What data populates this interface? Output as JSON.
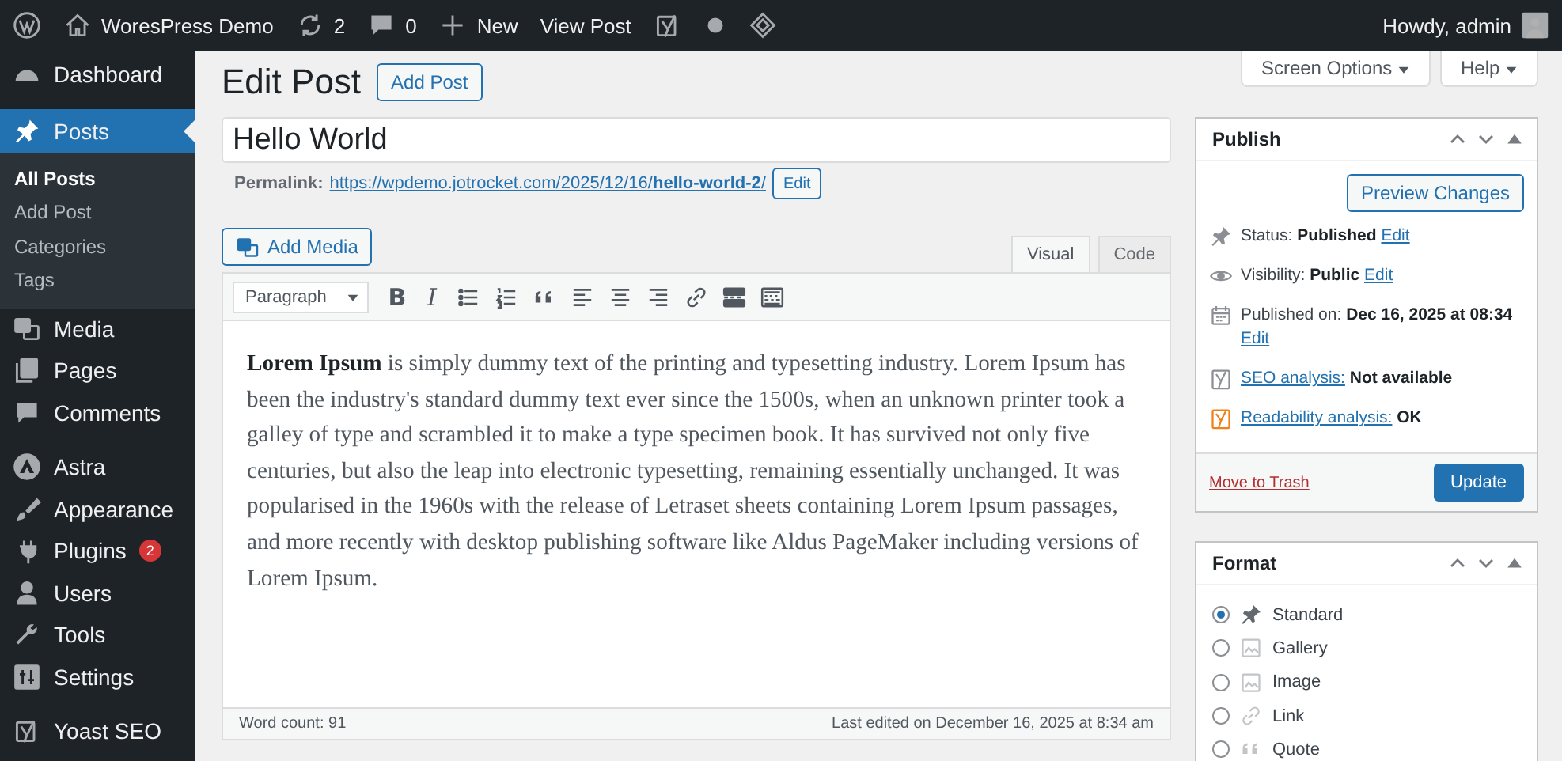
{
  "admin_bar": {
    "items": [
      {
        "kind": "wordpress"
      },
      {
        "kind": "home",
        "label": "WoresPress Demo"
      },
      {
        "kind": "updates",
        "label": "2"
      },
      {
        "kind": "comments",
        "label": "0"
      },
      {
        "kind": "plus",
        "label": "New"
      },
      {
        "kind": "text",
        "label": "View Post"
      },
      {
        "kind": "yoast"
      },
      {
        "kind": "dot"
      },
      {
        "kind": "diamond"
      }
    ],
    "account": "Howdy, admin"
  },
  "sidebar": {
    "groups": [
      {
        "items": [
          {
            "kind": "dashboard",
            "label": "Dashboard",
            "selected": false
          }
        ]
      },
      {
        "items": [
          {
            "kind": "pin",
            "label": "Posts",
            "selected": true,
            "children": [
              {
                "label": "All Posts",
                "selected": true
              },
              {
                "label": "Add Post",
                "selected": false
              },
              {
                "label": "Categories",
                "selected": false
              },
              {
                "label": "Tags",
                "selected": false
              }
            ]
          },
          {
            "kind": "media",
            "label": "Media",
            "selected": false
          },
          {
            "kind": "pages",
            "label": "Pages",
            "selected": false
          },
          {
            "kind": "comments",
            "label": "Comments",
            "selected": false
          }
        ]
      },
      {
        "items": [
          {
            "kind": "astra",
            "label": "Astra",
            "selected": false
          },
          {
            "kind": "appearance",
            "label": "Appearance",
            "selected": false
          },
          {
            "kind": "plugins",
            "label": "Plugins",
            "selected": false,
            "badge": "2"
          },
          {
            "kind": "users",
            "label": "Users",
            "selected": false
          },
          {
            "kind": "tools",
            "label": "Tools",
            "selected": false
          },
          {
            "kind": "settings",
            "label": "Settings",
            "selected": false
          }
        ]
      },
      {
        "items": [
          {
            "kind": "yoast",
            "label": "Yoast SEO",
            "selected": false
          }
        ]
      }
    ]
  },
  "screen_meta": [
    "Screen Options",
    "Help"
  ],
  "header": {
    "title": "Edit Post",
    "button": "Add Post"
  },
  "post_title": "Hello World",
  "permalink": {
    "label": "Permalink:",
    "url": "https://wpdemo.jotrocket.com/2025/12/16/**hello-world-2**/",
    "edit": "Edit"
  },
  "editor": {
    "add_media": "Add Media",
    "tabs": [
      {
        "label": "Visual",
        "selected": true
      },
      {
        "label": "Code",
        "selected": false
      }
    ],
    "format": "Paragraph",
    "tools": [
      {
        "kind": "bold",
        "label": "B"
      },
      {
        "kind": "italic",
        "label": "I"
      },
      {
        "kind": "bullets"
      },
      {
        "kind": "numbers"
      },
      {
        "kind": "quote"
      },
      {
        "kind": "align-left"
      },
      {
        "kind": "align-center"
      },
      {
        "kind": "align-right"
      },
      {
        "kind": "link"
      },
      {
        "kind": "more"
      },
      {
        "kind": "toggle"
      }
    ],
    "content": "**Lorem Ipsum** is simply dummy text of the printing and typesetting industry. Lorem Ipsum has been the industry's standard dummy text ever since the 1500s, when an unknown printer took a galley of type and scrambled it to make a type specimen book. It has survived not only five centuries, but also the leap into electronic typesetting, remaining essentially unchanged. It was popularised in the 1960s with the release of Letraset sheets containing Lorem Ipsum passages, and more recently with desktop publishing software like Aldus PageMaker including versions of Lorem Ipsum.",
    "word_count": "Word count: 91",
    "last_edited": "Last edited on December 16, 2025 at 8:34 am"
  },
  "publish": {
    "title": "Publish",
    "preview": "Preview Changes",
    "rows": [
      {
        "kind": "pin",
        "label": "Status:",
        "value": "Published",
        "link": "Edit"
      },
      {
        "kind": "eye",
        "label": "Visibility:",
        "value": "Public",
        "link": "Edit"
      },
      {
        "kind": "calendar",
        "label": "Published on:",
        "value": "Dec 16, 2025 at 08:34",
        "link": "Edit"
      },
      {
        "kind": "seo",
        "link": "SEO analysis:",
        "value": "Not available"
      },
      {
        "kind": "readability",
        "link": "Readability analysis:",
        "value": "OK"
      }
    ],
    "trash": "Move to Trash",
    "update": "Update"
  },
  "format_box": {
    "title": "Format",
    "options": [
      {
        "kind": "pin",
        "label": "Standard",
        "selected": true
      },
      {
        "kind": "gallery",
        "label": "Gallery",
        "selected": false
      },
      {
        "kind": "image",
        "label": "Image",
        "selected": false
      },
      {
        "kind": "link",
        "label": "Link",
        "selected": false
      },
      {
        "kind": "quote",
        "label": "Quote",
        "selected": false
      }
    ]
  }
}
